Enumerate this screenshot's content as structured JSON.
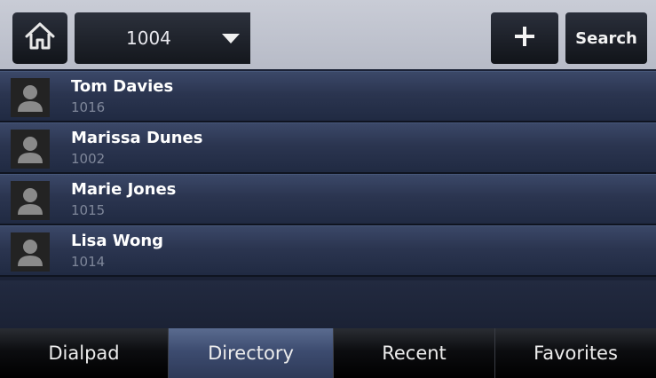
{
  "header": {
    "home_icon": "home-icon",
    "line_value": "1004",
    "add_icon": "plus-icon",
    "search_label": "Search"
  },
  "contacts": [
    {
      "name": "Tom Davies",
      "number": "1016"
    },
    {
      "name": "Marissa Dunes",
      "number": "1002"
    },
    {
      "name": "Marie Jones",
      "number": "1015"
    },
    {
      "name": "Lisa Wong",
      "number": "1014"
    }
  ],
  "tabs": [
    {
      "label": "Dialpad",
      "active": false
    },
    {
      "label": "Directory",
      "active": true
    },
    {
      "label": "Recent",
      "active": false
    },
    {
      "label": "Favorites",
      "active": false
    }
  ],
  "colors": {
    "header_bg": "#c9ccd6",
    "row_bg": "#2b3550",
    "active_tab": "#3d4c70",
    "page_bg": "#1b2236"
  }
}
